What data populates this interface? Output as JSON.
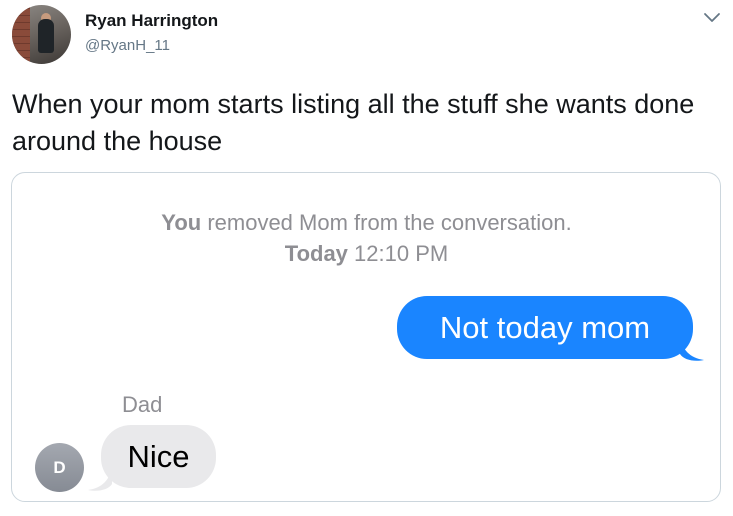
{
  "tweet": {
    "author_name": "Ryan Harrington",
    "author_handle": "@RyanH_11",
    "text": "When your mom starts listing all the stuff she wants done around the house"
  },
  "colors": {
    "sent_bubble": "#1a85ff",
    "received_bubble": "#e9e9eb",
    "system_text": "#8e8e93"
  },
  "icons": [
    "chevron-down-icon"
  ],
  "conversation": {
    "system_message": {
      "actor": "You",
      "text": "removed Mom from the conversation."
    },
    "timestamp": {
      "day": "Today",
      "time": "12:10 PM"
    },
    "sent_message": "Not today mom",
    "received": {
      "sender": "Dad",
      "avatar_initial": "D",
      "text": "Nice"
    }
  }
}
